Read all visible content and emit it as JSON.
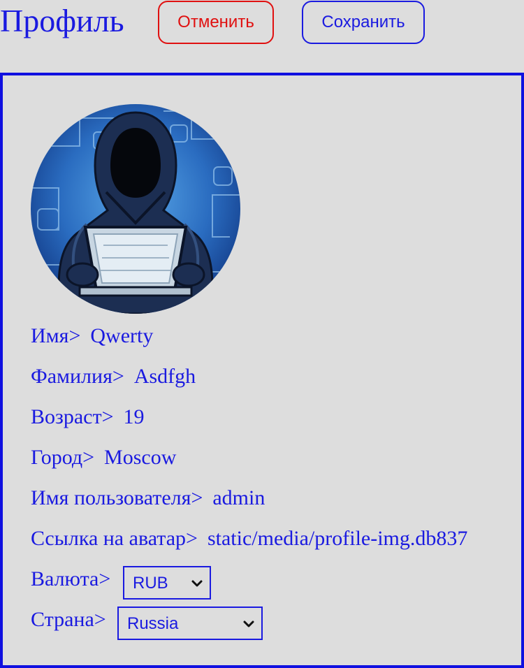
{
  "header": {
    "title": "Профиль",
    "cancel_label": "Отменить",
    "save_label": "Сохранить"
  },
  "profile": {
    "avatar_icon": "hacker-avatar-image",
    "fields": [
      {
        "label": "Имя>",
        "value": "Qwerty"
      },
      {
        "label": "Фамилия>",
        "value": "Asdfgh"
      },
      {
        "label": "Возраст>",
        "value": "19"
      },
      {
        "label": "Город>",
        "value": "Moscow"
      },
      {
        "label": "Имя пользователя>",
        "value": "admin"
      },
      {
        "label": "Ссылка на аватар>",
        "value": "static/media/profile-img.db837"
      }
    ],
    "currency": {
      "label": "Валюта>",
      "value": "RUB"
    },
    "country": {
      "label": "Страна>",
      "value": "Russia"
    }
  },
  "colors": {
    "accent": "#1a1ae0",
    "danger": "#e01010",
    "background": "#dddddd"
  }
}
